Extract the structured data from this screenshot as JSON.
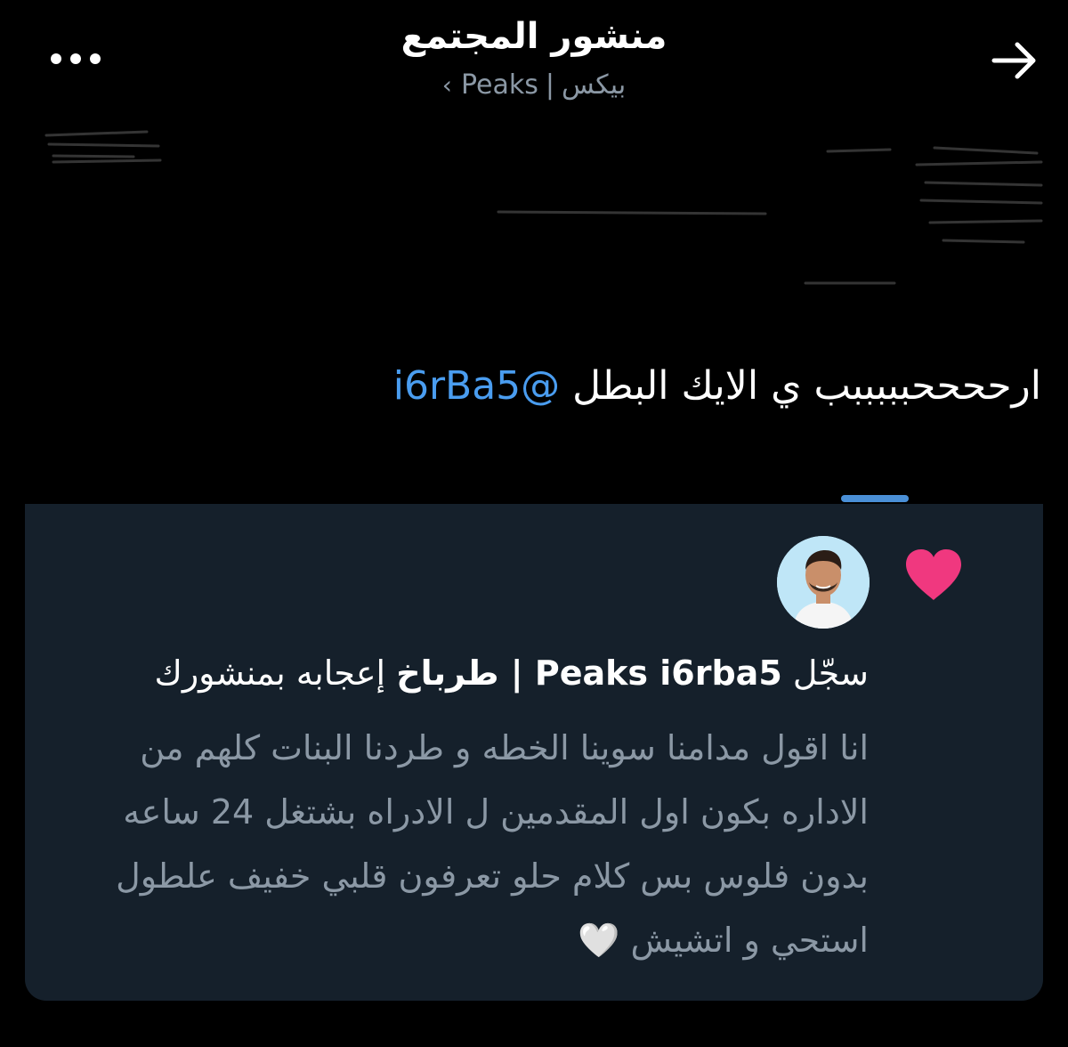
{
  "header": {
    "title": "منشور المجتمع",
    "community": "بيكس",
    "separator": "|",
    "community_latin": "Peaks",
    "chevron": "‹",
    "more_icon": "more-horizontal-icon",
    "forward_icon": "arrow-right-icon"
  },
  "tweet": {
    "text": "ارححححبببببب ي الايك البطل ",
    "mention": "@i6rBa5"
  },
  "notification": {
    "prefix": "سجّل ",
    "user": "Peaks i6rba5 | طرباخ",
    "suffix": " إعجابه بمنشورك",
    "heart_color": "#f0387f",
    "body_lines": [
      "انا اقول مدامنا سوينا الخطه و طردنا البنات كلهم من",
      "الاداره بكون اول المقدمين ل الادراه بشتغل 24 ساعه",
      "بدون فلوس بس كلام حلو تعرفون قلبي خفيف علطول",
      "استحي و اتشيش 🤍"
    ]
  },
  "colors": {
    "background": "#000000",
    "card": "#15202b",
    "accent": "#4a9df0",
    "muted": "#8b98a5"
  }
}
